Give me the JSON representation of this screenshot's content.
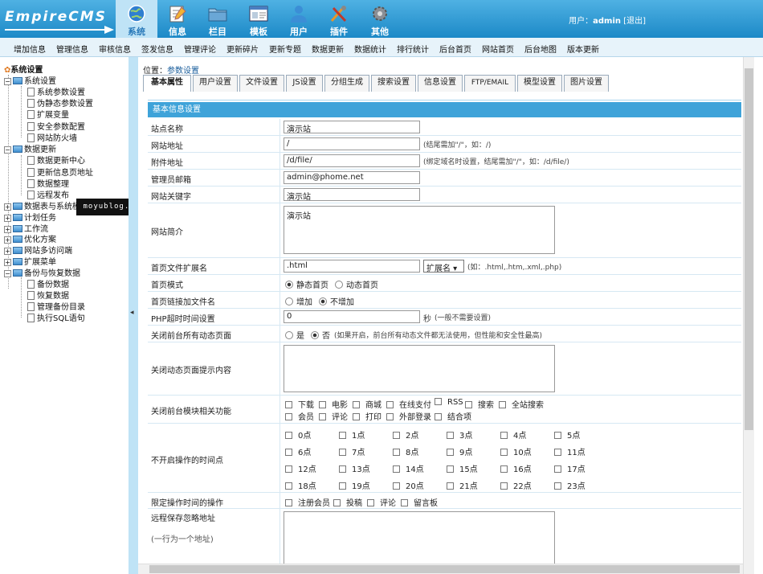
{
  "brand": "EmpireCMS",
  "colors": {
    "header": "#2b9ad4",
    "active_tab": "#bfe3f6",
    "section_header": "#3fa3d9",
    "link": "#1a5e9c"
  },
  "main_tabs": [
    {
      "label": "系统",
      "icon": "globe-icon"
    },
    {
      "label": "信息",
      "icon": "notepad-icon"
    },
    {
      "label": "栏目",
      "icon": "folder-icon"
    },
    {
      "label": "模板",
      "icon": "window-icon"
    },
    {
      "label": "用户",
      "icon": "user-icon"
    },
    {
      "label": "插件",
      "icon": "tools-icon"
    },
    {
      "label": "其他",
      "icon": "gear-icon"
    }
  ],
  "user": {
    "prefix": "用户：",
    "name": "admin",
    "logout": "[退出]"
  },
  "sub_menu": [
    "增加信息",
    "管理信息",
    "审核信息",
    "签发信息",
    "管理评论",
    "更新碎片",
    "更新专题",
    "数据更新",
    "数据统计",
    "排行统计",
    "后台首页",
    "网站首页",
    "后台地图",
    "版本更新"
  ],
  "tree": {
    "root": "系统设置",
    "g1": {
      "label": "系统设置",
      "items": [
        "系统参数设置",
        "伪静态参数设置",
        "扩展变量",
        "安全参数配置",
        "网站防火墙"
      ]
    },
    "g2": {
      "label": "数据更新",
      "items": [
        "数据更新中心",
        "更新信息页地址",
        "数据整理",
        "远程发布"
      ]
    },
    "collapsed": [
      "数据表与系统模型",
      "计划任务",
      "工作流",
      "优化方案",
      "网站多访问端",
      "扩展菜单"
    ],
    "g3": {
      "label": "备份与恢复数据",
      "items": [
        "备份数据",
        "恢复数据",
        "管理备份目录",
        "执行SQL语句"
      ]
    }
  },
  "watermark": "moyublog.com",
  "splitter": "◂",
  "breadcrumb": {
    "prefix": "位置：",
    "link": "参数设置"
  },
  "form_tabs": [
    "基本属性",
    "用户设置",
    "文件设置",
    "JS设置",
    "分组生成",
    "搜索设置",
    "信息设置",
    "FTP/EMAIL",
    "模型设置",
    "图片设置"
  ],
  "section_title": "基本信息设置",
  "fields": {
    "site_name": {
      "label": "站点名称",
      "value": "演示站"
    },
    "site_url": {
      "label": "网站地址",
      "value": "/",
      "hint": "(结尾需加\"/\"，如：/)"
    },
    "file_url": {
      "label": "附件地址",
      "value": "/d/file/",
      "hint": "(绑定域名时设置，结尾需加\"/\"，如：/d/file/)"
    },
    "email": {
      "label": "管理员邮箱",
      "value": "admin@phome.net"
    },
    "keywords": {
      "label": "网站关键字",
      "value": "演示站"
    },
    "intro": {
      "label": "网站简介",
      "value": "演示站"
    },
    "ext": {
      "label": "首页文件扩展名",
      "value": ".html",
      "select": "扩展名 ▾",
      "hint": "(如：.html,.htm,.xml,.php)"
    },
    "mode": {
      "label": "首页模式",
      "opt1": "静态首页",
      "opt2": "动态首页"
    },
    "link_name": {
      "label": "首页链接加文件名",
      "opt1": "增加",
      "opt2": "不增加"
    },
    "timeout": {
      "label": "PHP超时时间设置",
      "value": "0",
      "unit": "秒",
      "hint": "(一般不需要设置)"
    },
    "close_dyn": {
      "label": "关闭前台所有动态页面",
      "opt1": "是",
      "opt2": "否",
      "hint": "(如果开启，前台所有动态文件都无法使用，但性能和安全性最高)"
    },
    "close_msg": {
      "label": "关闭动态页面提示内容"
    },
    "close_mod": {
      "label": "关闭前台模块相关功能",
      "row1": [
        "下载",
        "电影",
        "商城",
        "在线支付",
        "RSS",
        "搜索",
        "全站搜索"
      ],
      "row2": [
        "会员",
        "评论",
        "打印",
        "外部登录",
        "结合项"
      ]
    },
    "hours": {
      "label": "不开启操作的时间点",
      "items": [
        "0点",
        "1点",
        "2点",
        "3点",
        "4点",
        "5点",
        "6点",
        "7点",
        "8点",
        "9点",
        "10点",
        "11点",
        "12点",
        "13点",
        "14点",
        "15点",
        "16点",
        "17点",
        "18点",
        "19点",
        "20点",
        "21点",
        "22点",
        "23点"
      ]
    },
    "limit_ops": {
      "label": "限定操作时间的操作",
      "items": [
        "注册会员",
        "投稿",
        "评论",
        "留言板"
      ]
    },
    "remote": {
      "label": "远程保存忽略地址",
      "note": "(一行为一个地址)"
    }
  }
}
